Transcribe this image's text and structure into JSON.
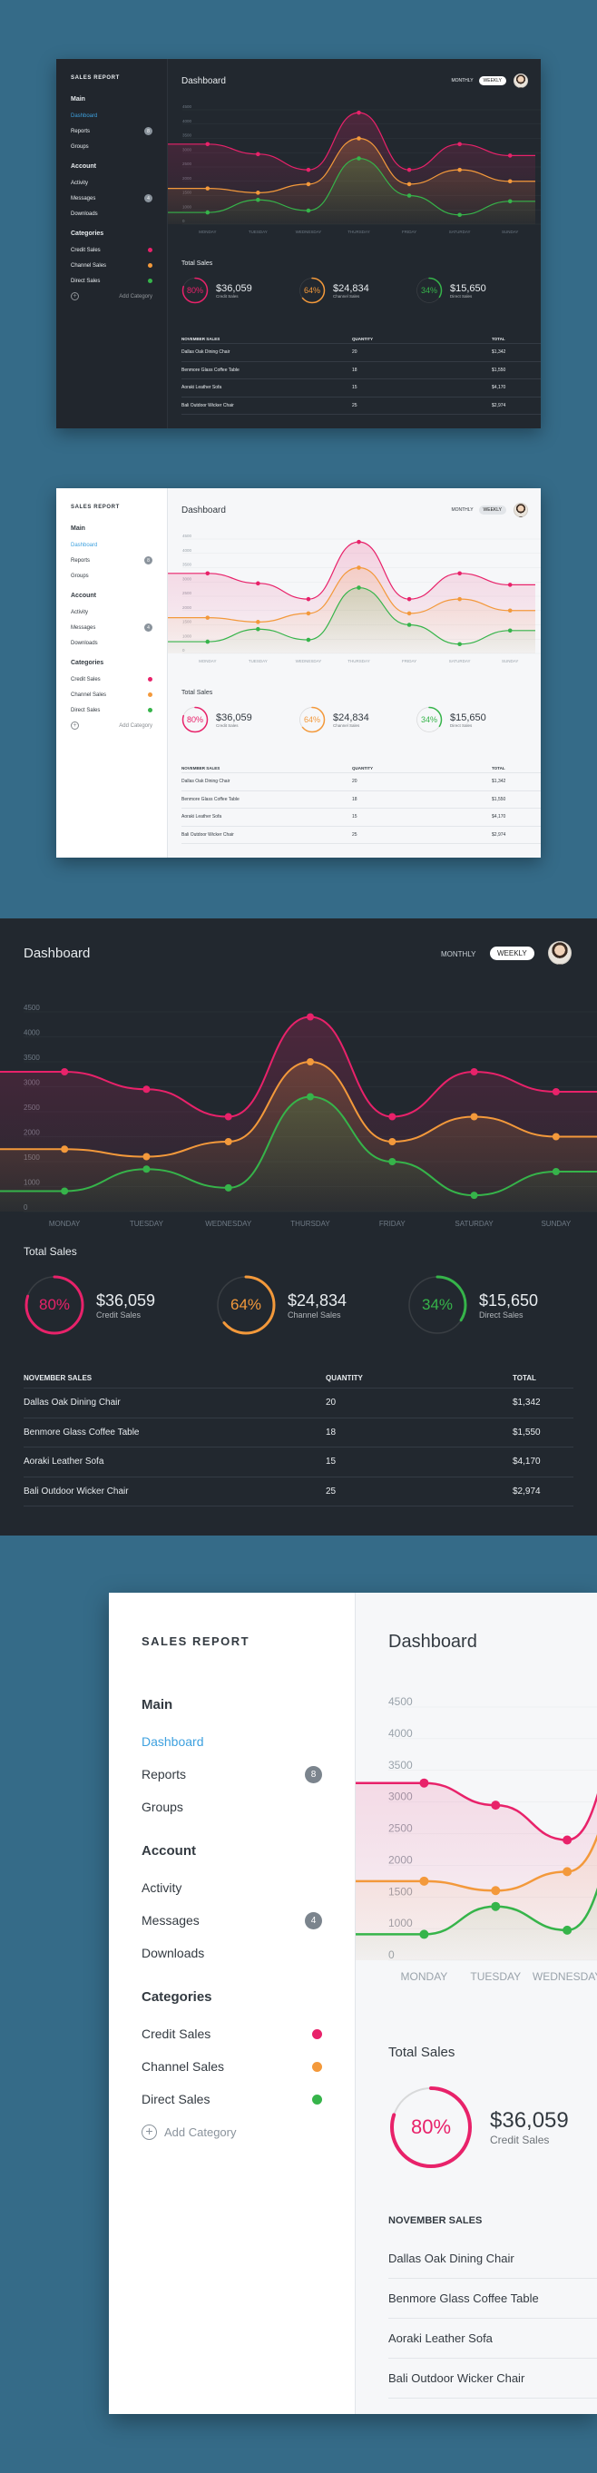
{
  "brand": "SALES REPORT",
  "sidebar": {
    "main_heading": "Main",
    "main_items": [
      {
        "label": "Dashboard",
        "badge": ""
      },
      {
        "label": "Reports",
        "badge": "8"
      },
      {
        "label": "Groups",
        "badge": ""
      }
    ],
    "account_heading": "Account",
    "account_items": [
      {
        "label": "Activity",
        "badge": ""
      },
      {
        "label": "Messages",
        "badge": "4"
      },
      {
        "label": "Downloads",
        "badge": ""
      }
    ],
    "categories_heading": "Categories",
    "categories": [
      {
        "label": "Credit Sales",
        "color": "#e8226a"
      },
      {
        "label": "Channel Sales",
        "color": "#f3993b"
      },
      {
        "label": "Direct Sales",
        "color": "#36b44a"
      }
    ],
    "add_category": "Add Category"
  },
  "header": {
    "title": "Dashboard",
    "toggle_monthly": "MONTHLY",
    "toggle_weekly": "WEEKLY"
  },
  "chart_data": {
    "type": "area",
    "categories": [
      "MONDAY",
      "TUESDAY",
      "WEDNESDAY",
      "THURSDAY",
      "FRIDAY",
      "SATURDAY",
      "SUNDAY"
    ],
    "yticks": [
      "0",
      "1000",
      "1500",
      "2000",
      "2500",
      "3000",
      "3500",
      "4000",
      "4500"
    ],
    "ylim": [
      0,
      4500
    ],
    "series": [
      {
        "color": "#e8226a",
        "values": [
          3300,
          2950,
          2400,
          4400,
          2400,
          3300,
          2900
        ]
      },
      {
        "color": "#f3993b",
        "values": [
          1750,
          1600,
          1900,
          3500,
          1900,
          2400,
          2000
        ]
      },
      {
        "color": "#36b44a",
        "values": [
          820,
          1350,
          950,
          2800,
          1500,
          650,
          1300
        ]
      }
    ]
  },
  "total_sales": {
    "title": "Total Sales",
    "items": [
      {
        "percent": "80%",
        "pct": 0.8,
        "amount": "$36,059",
        "label": "Credit Sales",
        "color": "#e8226a"
      },
      {
        "percent": "64%",
        "pct": 0.64,
        "amount": "$24,834",
        "label": "Channel Sales",
        "color": "#f3993b"
      },
      {
        "percent": "34%",
        "pct": 0.34,
        "amount": "$15,650",
        "label": "Direct Sales",
        "color": "#36b44a"
      }
    ]
  },
  "table": {
    "headers": [
      "NOVEMBER SALES",
      "QUANTITY",
      "TOTAL"
    ],
    "rows": [
      [
        "Dallas Oak Dining Chair",
        "20",
        "$1,342"
      ],
      [
        "Benmore Glass Coffee Table",
        "18",
        "$1,550"
      ],
      [
        "Aoraki Leather Sofa",
        "15",
        "$4,170"
      ],
      [
        "Bali Outdoor Wicker Chair",
        "25",
        "$2,974"
      ]
    ]
  },
  "zoom_table_rows": [
    "Dallas Oak Dining Chair",
    "Benmore Glass Coffee Table",
    "Aoraki Leather Sofa",
    "Bali Outdoor Wicker Chair"
  ]
}
